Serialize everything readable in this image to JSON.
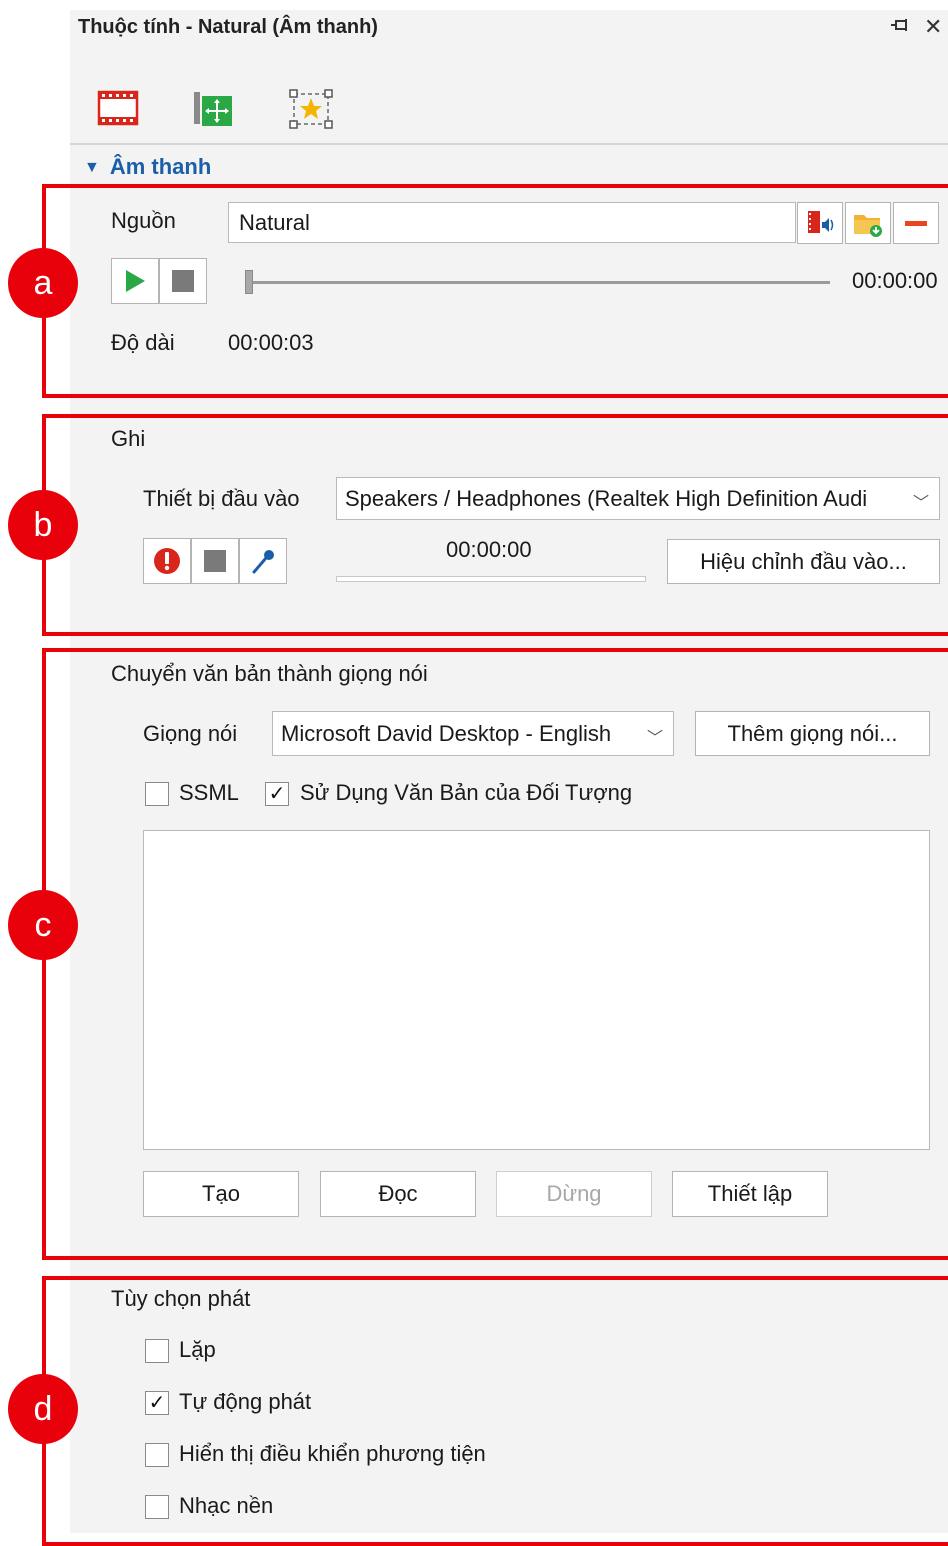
{
  "window": {
    "title": "Thuộc tính - Natural (Âm thanh)",
    "pin_icon": "pin-icon",
    "close_icon": "close-icon"
  },
  "tabs": [
    {
      "icon": "film-strip-icon"
    },
    {
      "icon": "move-image-icon"
    },
    {
      "icon": "star-frame-icon"
    }
  ],
  "section": {
    "title": "Âm thanh"
  },
  "markers": [
    "a",
    "b",
    "c",
    "d"
  ],
  "audio": {
    "source_label": "Nguồn",
    "source_value": "Natural",
    "position_time": "00:00:00",
    "duration_label": "Độ dài",
    "duration_value": "00:00:03",
    "progress": 0
  },
  "record": {
    "title": "Ghi",
    "input_device_label": "Thiết bị đầu vào",
    "input_device_value": "Speakers / Headphones (Realtek High Definition Audi",
    "time": "00:00:00",
    "adjust_button": "Hiệu chỉnh đầu vào..."
  },
  "tts": {
    "title": "Chuyển văn bản thành giọng nói",
    "voice_label": "Giọng nói",
    "voice_value": "Microsoft David Desktop - English",
    "add_voice_button": "Thêm giọng nói...",
    "ssml_label": "SSML",
    "ssml_checked": false,
    "use_text_label": "Sử Dụng Văn Bản của Đối Tượng",
    "use_text_checked": true,
    "text_value": "",
    "create_button": "Tạo",
    "read_button": "Đọc",
    "stop_button": "Dừng",
    "settings_button": "Thiết lập"
  },
  "playback": {
    "title": "Tùy chọn phát",
    "options": [
      {
        "label": "Lặp",
        "checked": false
      },
      {
        "label": "Tự động phát",
        "checked": true
      },
      {
        "label": "Hiển thị điều khiển phương tiện",
        "checked": false
      },
      {
        "label": "Nhạc nền",
        "checked": false
      }
    ]
  },
  "colors": {
    "highlight_red": "#e8000b",
    "accent_blue": "#1a5fa8",
    "play_green": "#2aa845"
  }
}
